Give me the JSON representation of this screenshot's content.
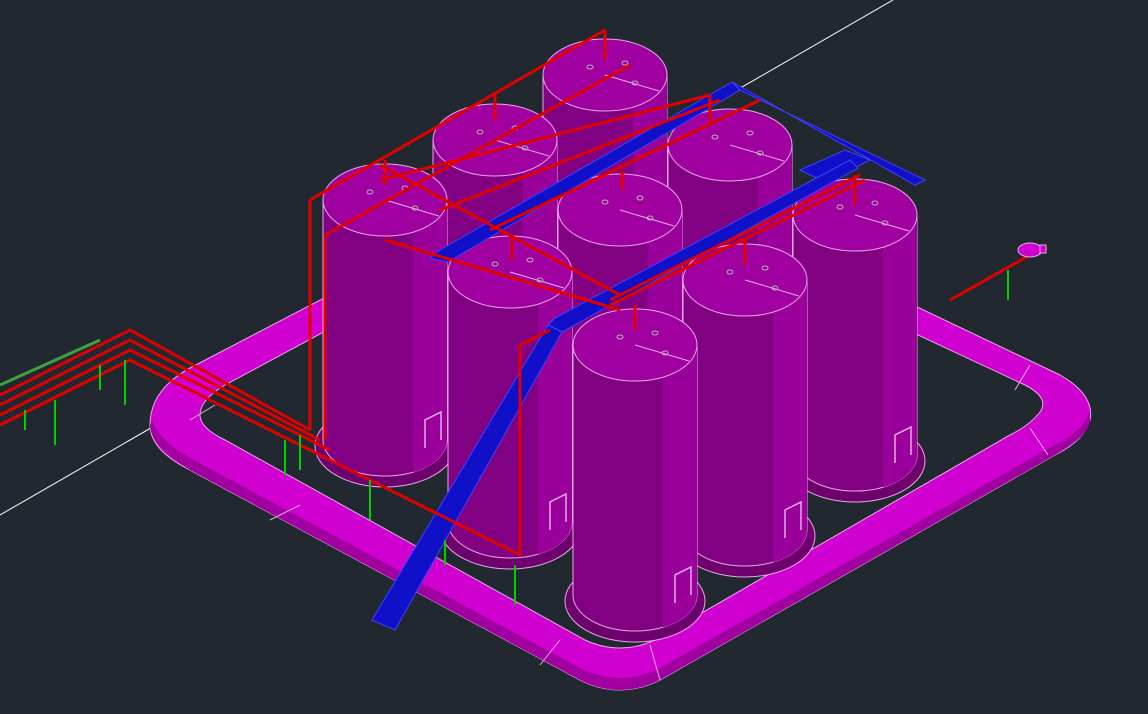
{
  "view": {
    "background": "#212830",
    "projection": "isometric"
  },
  "colors": {
    "tank_body": "#820082",
    "tank_dark": "#6E006E",
    "tank_light": "#9A009A",
    "tank_top": "#A000A0",
    "edge": "#E8A8E8",
    "bund": "#D000D0",
    "bund_dark": "#A000A0",
    "bund_light": "#E000E0",
    "piping": "#E00000",
    "piping_highlight": "#FF4040",
    "tray": "#1010C8",
    "tray_edge": "#4040FF",
    "supports": "#00D000",
    "supports_alt": "#40A040",
    "crosshair": "#FFFFFF",
    "fittings": "#B0B0B0"
  },
  "scene": {
    "tank_count": 9,
    "tank_grid": "3x3",
    "bund_wall": "rounded-rectangle",
    "cable_tray_count": 2
  }
}
